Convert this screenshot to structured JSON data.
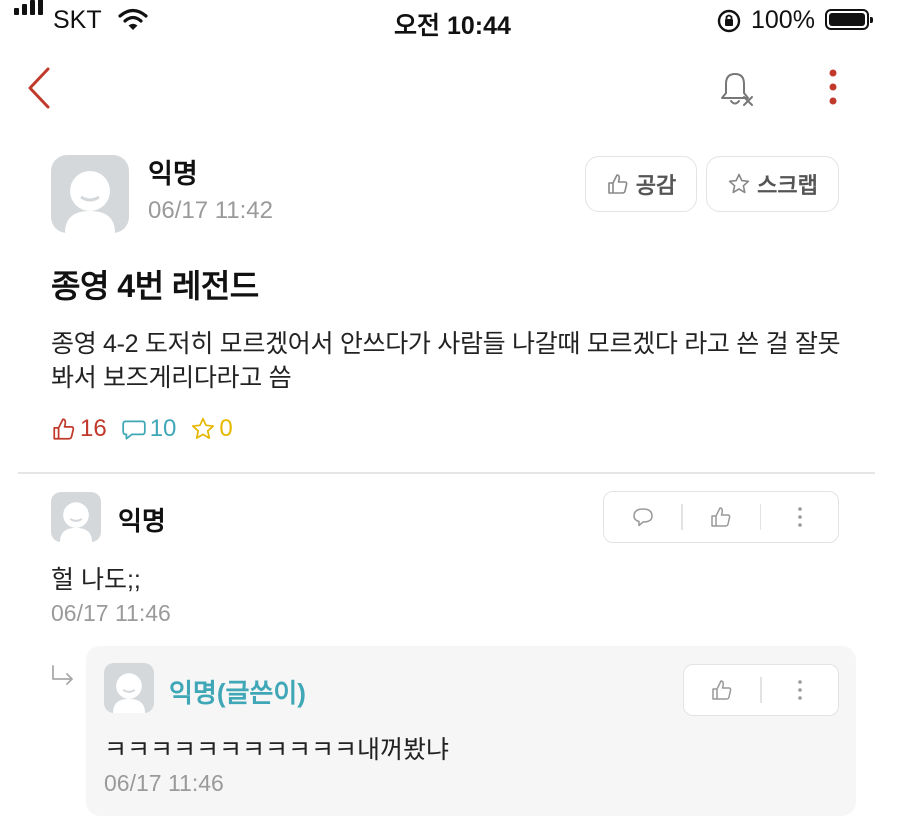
{
  "status_bar": {
    "carrier": "SKT",
    "time": "오전 10:44",
    "battery": "100%"
  },
  "header": {
    "back_icon": "chevron-left-icon",
    "bell_icon": "bell-off-icon",
    "more_icon": "vertical-dots-icon"
  },
  "post": {
    "author": "익명",
    "time": "06/17 11:42",
    "like_button": "공감",
    "scrap_button": "스크랩",
    "title": "종영 4번 레전드",
    "body": "종영 4-2 도저히 모르겠어서 안쓰다가 사람들 나갈때  모르겠다 라고 쓴 걸 잘못봐서 보즈게리다라고 씀",
    "likes": "16",
    "comments": "10",
    "scraps": "0"
  },
  "comments": [
    {
      "author": "익명",
      "text": "헐 나도;;",
      "time": "06/17 11:46",
      "replies": [
        {
          "author": "익명(글쓴이)",
          "text": "ㅋㅋㅋㅋㅋㅋㅋㅋㅋㅋㅋ내꺼봤냐",
          "time": "06/17 11:46"
        }
      ]
    }
  ],
  "colors": {
    "accent_red": "#c0392b",
    "comment_blue": "#3fa7b6",
    "scrap_yellow": "#e6b800",
    "back_red": "#c0392b"
  }
}
